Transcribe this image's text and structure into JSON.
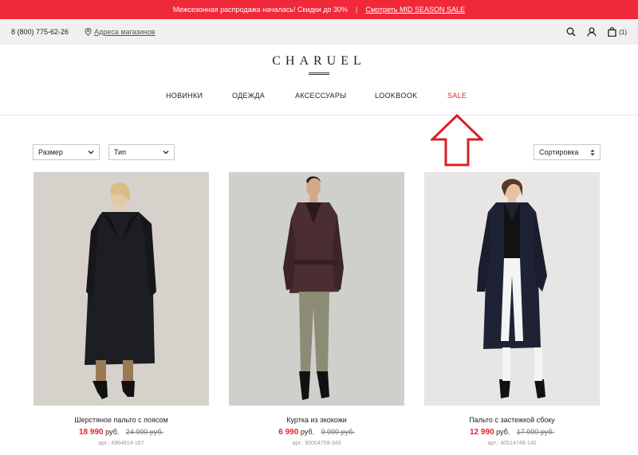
{
  "promo": {
    "text": "Межсезонная распродажа началась! Скидки до 30%",
    "separator": "|",
    "link": "Смотреть MID SEASON SALE"
  },
  "topbar": {
    "phone": "8 (800) 775-62-26",
    "stores_link": "Адреса магазинов",
    "cart_count": "(1)"
  },
  "brand": {
    "logo": "CHARUEL"
  },
  "nav": {
    "items": [
      "НОВИНКИ",
      "ОДЕЖДА",
      "АКСЕССУАРЫ",
      "LOOKBOOK",
      "SALE"
    ]
  },
  "filters": {
    "size": "Размер",
    "type": "Тип",
    "sort": "Сортировка"
  },
  "products": [
    {
      "name": "Шерстяное пальто с поясом",
      "price": "18 990",
      "currency": "руб.",
      "old_price": "24 990 руб.",
      "article": "арт.: 4964814-167"
    },
    {
      "name": "Куртка из экокожи",
      "price": "6 990",
      "currency": "руб.",
      "old_price": "9 990 руб.",
      "article": "арт.: 90004759-343"
    },
    {
      "name": "Пальто с застежкой сбоку",
      "price": "12 990",
      "currency": "руб.",
      "old_price": "17 990 руб.",
      "article": "арт.: 40514748-140"
    }
  ],
  "colors": {
    "accent": "#f0293a",
    "sale": "#e8202f",
    "arrow": "#d8202a"
  },
  "icons": [
    "location-pin-icon",
    "search-icon",
    "user-icon",
    "bag-icon",
    "chevron-down-icon",
    "sort-arrows-icon",
    "arrow-up-icon"
  ]
}
